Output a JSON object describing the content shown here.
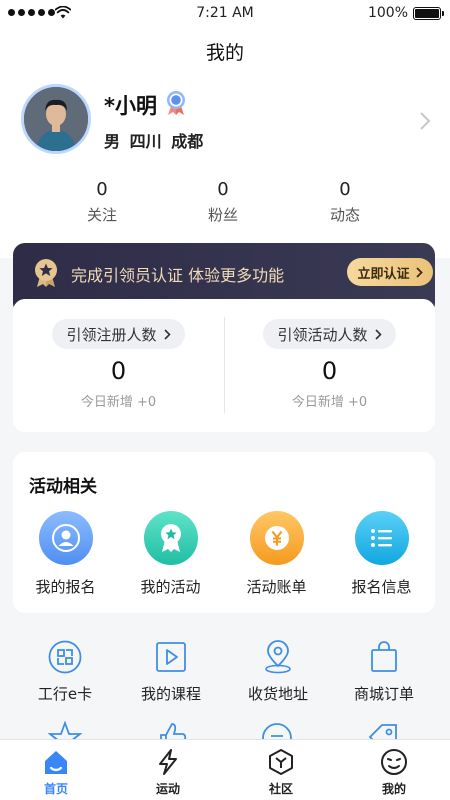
{
  "status_bar": {
    "time": "7:21 AM",
    "battery": "100%"
  },
  "header": {
    "title": "我的"
  },
  "profile": {
    "name": "*小明",
    "gender": "男",
    "province": "四川",
    "city": "成都"
  },
  "stats": [
    {
      "value": "0",
      "label": "关注"
    },
    {
      "value": "0",
      "label": "粉丝"
    },
    {
      "value": "0",
      "label": "动态"
    }
  ],
  "certification": {
    "text": "完成引领员认证 体验更多功能",
    "button": "立即认证"
  },
  "leads": [
    {
      "label": "引领注册人数",
      "value": "0",
      "today": "今日新增 +0"
    },
    {
      "label": "引领活动人数",
      "value": "0",
      "today": "今日新增 +0"
    }
  ],
  "activity": {
    "title": "活动相关",
    "items": [
      {
        "label": "我的报名",
        "icon": "user-icon",
        "color": "#5b9cf5"
      },
      {
        "label": "我的活动",
        "icon": "award-icon",
        "color": "#2ec9b0"
      },
      {
        "label": "活动账单",
        "icon": "yen-icon",
        "color": "#f7a632"
      },
      {
        "label": "报名信息",
        "icon": "list-icon",
        "color": "#22b5e8"
      }
    ]
  },
  "tools": [
    {
      "label": "工行e卡",
      "icon": "card-icon"
    },
    {
      "label": "我的课程",
      "icon": "play-icon"
    },
    {
      "label": "收货地址",
      "icon": "location-icon"
    },
    {
      "label": "商城订单",
      "icon": "bag-icon"
    }
  ],
  "tabbar": {
    "active_color": "#3a86f7",
    "items": [
      {
        "label": "首页",
        "icon": "home-icon"
      },
      {
        "label": "运动",
        "icon": "lightning-icon"
      },
      {
        "label": "社区",
        "icon": "cube-icon"
      },
      {
        "label": "我的",
        "icon": "face-icon"
      }
    ]
  }
}
